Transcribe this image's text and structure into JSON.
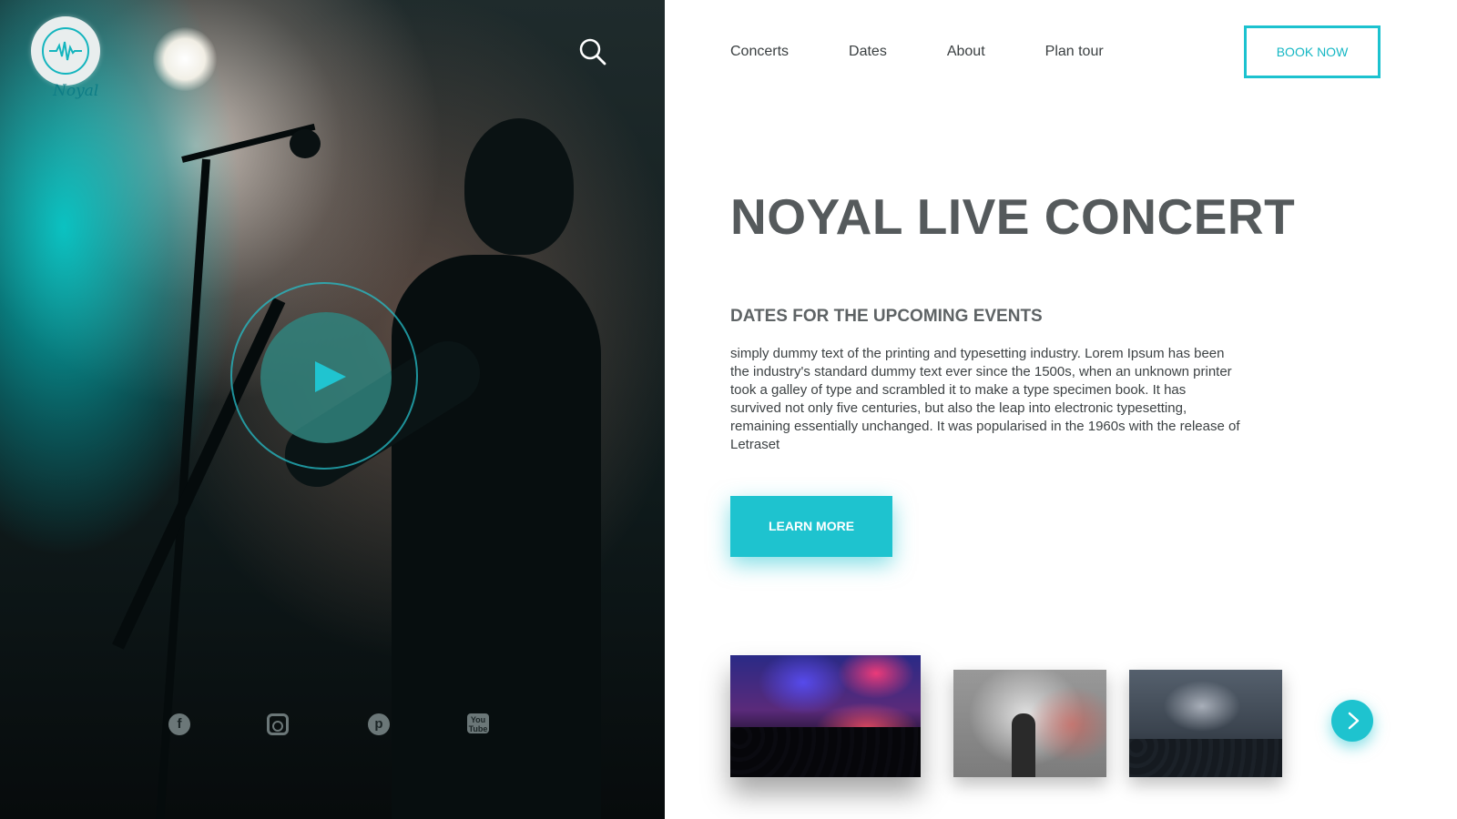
{
  "brand": {
    "logo_text": "Noyal",
    "accent_color": "#1ec3cf",
    "text_color": "#555a5c"
  },
  "hero": {
    "search_icon": "search-icon",
    "play_icon": "play-icon",
    "social": [
      {
        "name": "facebook-icon",
        "glyph": "f"
      },
      {
        "name": "instagram-icon",
        "glyph": ""
      },
      {
        "name": "pinterest-icon",
        "glyph": "p"
      },
      {
        "name": "youtube-icon",
        "glyph": "You Tube"
      }
    ]
  },
  "nav": {
    "items": [
      "Concerts",
      "Dates",
      "About",
      "Plan tour"
    ],
    "cta": "BOOK NOW"
  },
  "main": {
    "title": "NOYAL LIVE CONCERT",
    "subtitle": "DATES FOR THE UPCOMING EVENTS",
    "body": "simply dummy text of the printing and typesetting industry. Lorem Ipsum has been the industry's standard dummy text ever since the 1500s, when an unknown printer took a galley of type and scrambled it to make a type specimen book. It has survived not only five centuries, but also the leap into electronic typesetting, remaining essentially unchanged. It was popularised in the 1960s with the release of Letraset",
    "learn_more": "LEARN MORE"
  },
  "gallery": {
    "next_icon": "chevron-right-icon"
  }
}
